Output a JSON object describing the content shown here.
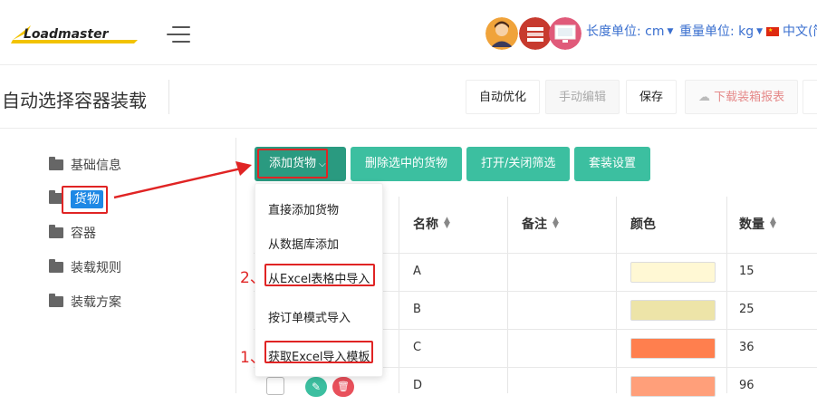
{
  "header": {
    "logo_text": "Loadmaster",
    "length_unit": "长度单位: cm",
    "weight_unit": "重量单位: kg",
    "language": "中文(简"
  },
  "toolbar": {
    "title": "自动选择容器装载",
    "auto_optimize": "自动优化",
    "manual_edit": "手动编辑",
    "save": "保存",
    "download_report": "下载装箱报表"
  },
  "sidebar": {
    "items": [
      "基础信息",
      "货物",
      "容器",
      "装载规则",
      "装载方案"
    ]
  },
  "actions": {
    "add_cargo": "添加货物",
    "delete_selected": "删除选中的货物",
    "toggle_filter": "打开/关闭筛选",
    "packing_settings": "套装设置"
  },
  "dropdown": {
    "items": [
      "直接添加货物",
      "从数据库添加",
      "从Excel表格中导入",
      "按订单模式导入",
      "获取Excel导入模板"
    ]
  },
  "table": {
    "columns": [
      "名称",
      "备注",
      "颜色",
      "数量"
    ],
    "rows": [
      {
        "name": "A",
        "color": "#fff8d4",
        "qty": "15"
      },
      {
        "name": "B",
        "color": "#ede4a8",
        "qty": "25"
      },
      {
        "name": "C",
        "color": "#ff7f4e",
        "qty": "36"
      },
      {
        "name": "D",
        "color": "#ff9f7a",
        "qty": "96"
      }
    ]
  },
  "annotations": {
    "step1": "1、",
    "step2": "2、"
  },
  "colors": {
    "accent_green": "#3cbfa0",
    "highlight_red": "#e02424",
    "selected_blue": "#1e88e5"
  }
}
